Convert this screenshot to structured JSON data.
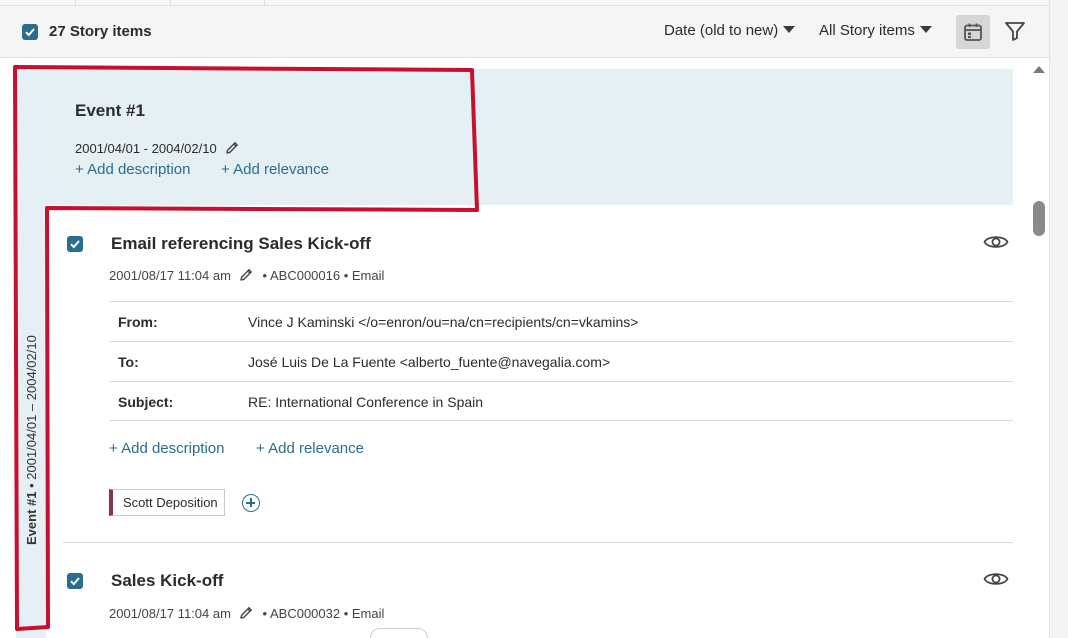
{
  "toolbar": {
    "count_label": "27 Story items",
    "sort_label": "Date (old to new)",
    "filter_scope_label": "All Story items",
    "icons": [
      "checkbox-checked-icon",
      "calendar-icon",
      "filter-icon",
      "chevron-down-icon"
    ]
  },
  "event": {
    "title": "Event #1",
    "dates": "2001/04/01 - 2004/02/10",
    "add_description": "+ Add description",
    "add_relevance": "+ Add relevance",
    "vertical_name": "Event #1",
    "vertical_dates": " • 2001/04/01 – 2004/02/10"
  },
  "items": [
    {
      "title": "Email referencing Sales Kick-off",
      "timestamp": "2001/08/17 11:04 am",
      "meta": "• ABC000016 • Email",
      "fields": [
        {
          "label": "From:",
          "value": "Vince J Kaminski </o=enron/ou=na/cn=recipients/cn=vkamins>"
        },
        {
          "label": "To:",
          "value": "José Luis De La Fuente <alberto_fuente@navegalia.com>"
        },
        {
          "label": "Subject:",
          "value": "RE: International Conference in Spain"
        }
      ],
      "add_description": "+ Add description",
      "add_relevance": "+ Add relevance",
      "tag": "Scott Deposition"
    },
    {
      "title": "Sales Kick-off",
      "timestamp": "2001/08/17 11:04 am",
      "meta": "• ABC000032 • Email"
    }
  ],
  "colors": {
    "accent": "#2a6d8c",
    "event_band": "#e4f0f4",
    "tag_stripe": "#8e2f5a",
    "annotation_red": "#c8102e"
  }
}
